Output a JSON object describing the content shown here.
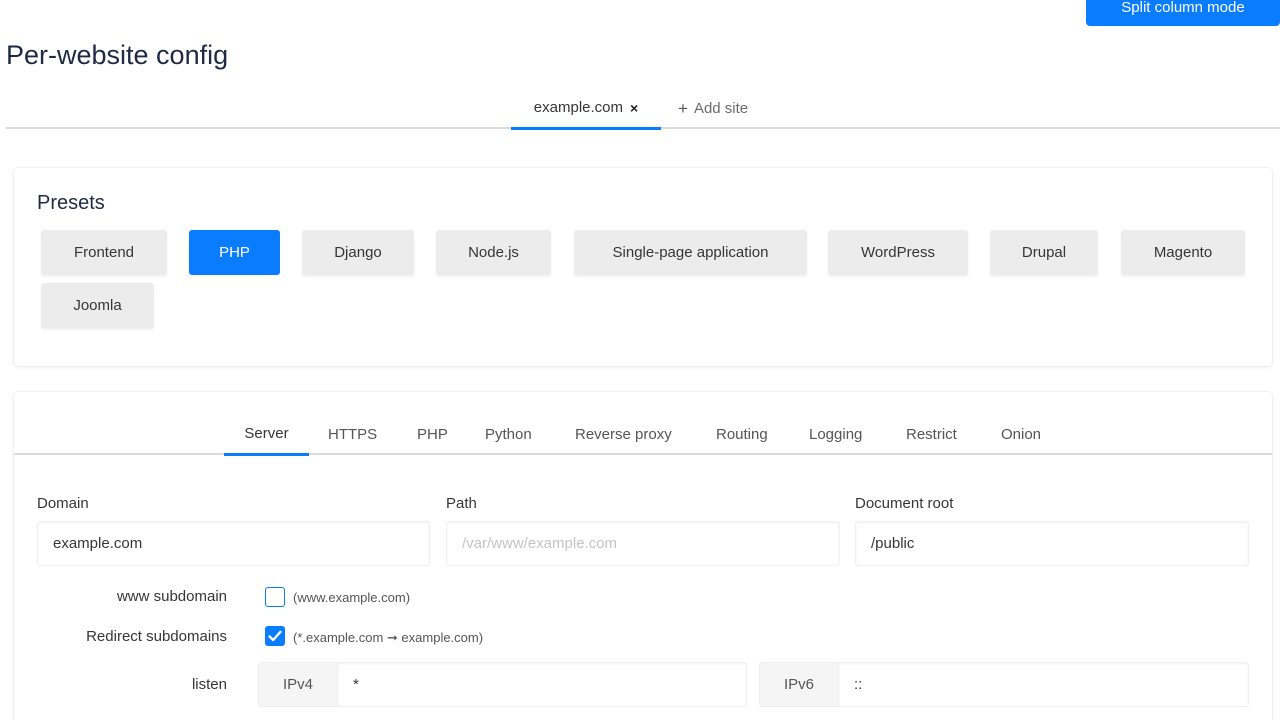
{
  "header": {
    "split_button": "Split column mode",
    "title": "Per-website config"
  },
  "site_tabs": {
    "active": "example.com",
    "close_glyph": "×",
    "add_label": "Add site",
    "add_glyph": "+"
  },
  "presets": {
    "title": "Presets",
    "items": [
      {
        "label": "Frontend",
        "active": false
      },
      {
        "label": "PHP",
        "active": true
      },
      {
        "label": "Django",
        "active": false
      },
      {
        "label": "Node.js",
        "active": false
      },
      {
        "label": "Single-page application",
        "active": false
      },
      {
        "label": "WordPress",
        "active": false
      },
      {
        "label": "Drupal",
        "active": false
      },
      {
        "label": "Magento",
        "active": false
      },
      {
        "label": "Joomla",
        "active": false
      }
    ]
  },
  "config_tabs": {
    "items": [
      "Server",
      "HTTPS",
      "PHP",
      "Python",
      "Reverse proxy",
      "Routing",
      "Logging",
      "Restrict",
      "Onion"
    ],
    "active": "Server"
  },
  "server": {
    "domain": {
      "label": "Domain",
      "value": "example.com"
    },
    "path": {
      "label": "Path",
      "value": "",
      "placeholder": "/var/www/example.com"
    },
    "document_root": {
      "label": "Document root",
      "value": "/public"
    },
    "www_subdomain": {
      "label": "www subdomain",
      "checked": false,
      "hint": "(www.example.com)"
    },
    "redirect_subdomains": {
      "label": "Redirect subdomains",
      "checked": true,
      "hint": "(*.example.com ➞ example.com)"
    },
    "listen": {
      "label": "listen",
      "ipv4_label": "IPv4",
      "ipv4_value": "*",
      "ipv6_label": "IPv6",
      "ipv6_value": "::"
    }
  },
  "colors": {
    "accent": "#0a7cff",
    "preset_bg": "#ececec",
    "title": "#1f2a44"
  }
}
